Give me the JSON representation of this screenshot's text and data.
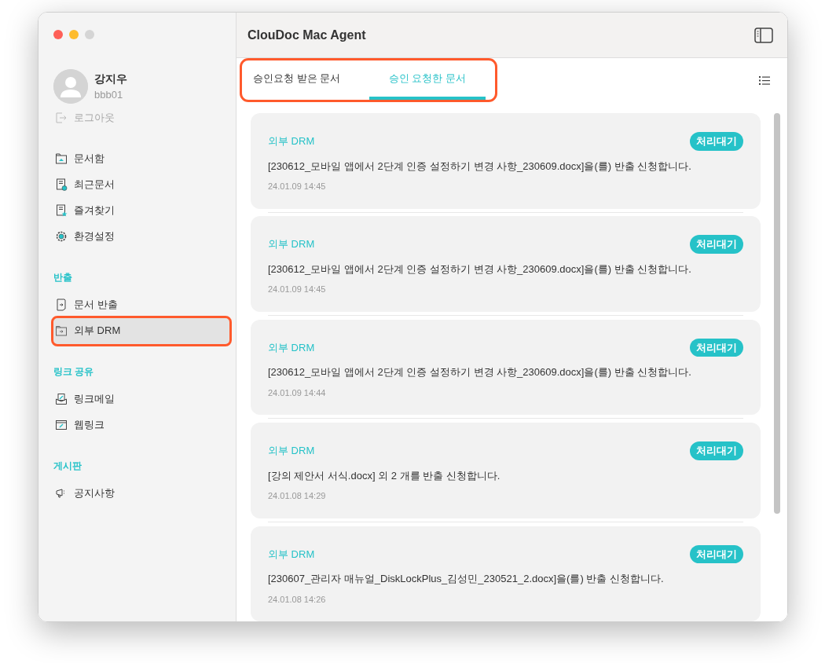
{
  "window": {
    "title": "ClouDoc Mac Agent"
  },
  "user": {
    "name": "강지우",
    "id": "bbb01",
    "logout": "로그아웃"
  },
  "sidebar": {
    "items": [
      {
        "label": "문서함",
        "kind": "folder",
        "selected": false,
        "highlighted": false
      },
      {
        "label": "최근문서",
        "kind": "recent",
        "selected": false,
        "highlighted": false
      },
      {
        "label": "즐겨찾기",
        "kind": "favorite",
        "selected": false,
        "highlighted": false
      },
      {
        "label": "환경설정",
        "kind": "settings",
        "selected": false,
        "highlighted": false
      }
    ],
    "sections": [
      {
        "title": "반출",
        "items": [
          {
            "label": "문서 반출",
            "kind": "export",
            "selected": false,
            "highlighted": false
          },
          {
            "label": "외부 DRM",
            "kind": "drm",
            "selected": true,
            "highlighted": true
          }
        ]
      },
      {
        "title": "링크 공유",
        "items": [
          {
            "label": "링크메일",
            "kind": "mail",
            "selected": false,
            "highlighted": false
          },
          {
            "label": "웹링크",
            "kind": "weblink",
            "selected": false,
            "highlighted": false
          }
        ]
      },
      {
        "title": "게시판",
        "items": [
          {
            "label": "공지사항",
            "kind": "notice",
            "selected": false,
            "highlighted": false
          }
        ]
      }
    ]
  },
  "tabs": {
    "highlighted": true,
    "items": [
      {
        "label": "승인요청 받은 문서",
        "selected": false
      },
      {
        "label": "승인 요청한 문서",
        "selected": true
      }
    ]
  },
  "requests": [
    {
      "type": "외부 DRM",
      "status": "처리대기",
      "message": "[230612_모바일 앱에서 2단계 인증 설정하기 변경 사항_230609.docx]을(를) 반출 신청합니다.",
      "time": "24.01.09 14:45"
    },
    {
      "type": "외부 DRM",
      "status": "처리대기",
      "message": "[230612_모바일 앱에서 2단계 인증 설정하기 변경 사항_230609.docx]을(를) 반출 신청합니다.",
      "time": "24.01.09 14:45"
    },
    {
      "type": "외부 DRM",
      "status": "처리대기",
      "message": "[230612_모바일 앱에서 2단계 인증 설정하기 변경 사항_230609.docx]을(를) 반출 신청합니다.",
      "time": "24.01.09 14:44"
    },
    {
      "type": "외부 DRM",
      "status": "처리대기",
      "message": "[강의 제안서 서식.docx] 외 2 개를 반출 신청합니다.",
      "time": "24.01.08 14:29"
    },
    {
      "type": "외부 DRM",
      "status": "처리대기",
      "message": "[230607_관리자 매뉴얼_DiskLockPlus_김성민_230521_2.docx]을(를) 반출 신청합니다.",
      "time": "24.01.08 14:26"
    }
  ]
}
